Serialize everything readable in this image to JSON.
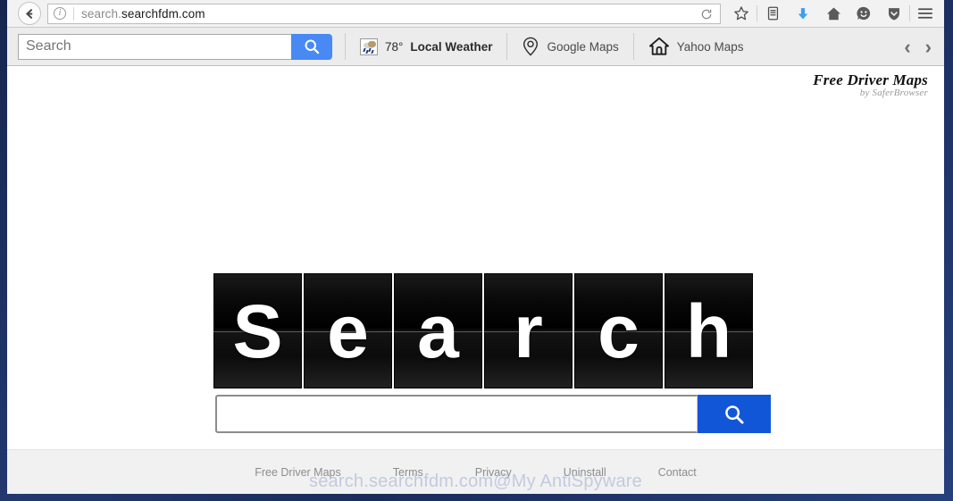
{
  "browser": {
    "back_icon": "back-arrow-icon",
    "site_info_icon": "info-circle-icon",
    "url_prefix": "search.",
    "url_domain": "searchfdm.com",
    "reload_icon": "reload-icon",
    "toolbar_icons": [
      {
        "name": "bookmark-star-icon",
        "glyph": "☆"
      },
      {
        "name": "library-icon",
        "glyph": "Ὅ6"
      },
      {
        "name": "downloads-icon",
        "glyph": "⬇"
      },
      {
        "name": "home-icon",
        "glyph": "⌂"
      },
      {
        "name": "smiley-face-icon",
        "glyph": "☺"
      },
      {
        "name": "shield-icon",
        "glyph": "⛊"
      },
      {
        "name": "hamburger-menu-icon",
        "glyph": "☰"
      }
    ]
  },
  "addon_toolbar": {
    "search_placeholder": "Search",
    "search_value": "",
    "search_button_icon": "magnifier-icon",
    "links": [
      {
        "name": "local-weather",
        "icon": "weather-icon",
        "temp": "78°",
        "label": "Local Weather"
      },
      {
        "name": "google-maps",
        "icon": "map-pin-icon",
        "label": "Google Maps"
      },
      {
        "name": "yahoo-maps",
        "icon": "home-outline-icon",
        "label": "Yahoo Maps"
      }
    ],
    "prev_arrow": "‹",
    "next_arrow": "›"
  },
  "page": {
    "brand_title": "Free Driver Maps",
    "brand_subtitle": "by SaferBrowser",
    "logo_letters": [
      "S",
      "e",
      "a",
      "r",
      "c",
      "h"
    ],
    "search_value": "",
    "search_placeholder": "",
    "search_button_icon": "magnifier-icon"
  },
  "footer": {
    "links": [
      {
        "name": "footer-link-free-driver-maps",
        "label": "Free Driver Maps"
      },
      {
        "name": "footer-link-terms",
        "label": "Terms"
      },
      {
        "name": "footer-link-privacy",
        "label": "Privacy"
      },
      {
        "name": "footer-link-uninstall",
        "label": "Uninstall"
      },
      {
        "name": "footer-link-contact",
        "label": "Contact"
      }
    ],
    "watermark": "search.searchfdm.com@My AntiSpyware"
  },
  "colors": {
    "accent_blue": "#1256d8",
    "toolbar_blue": "#4889f4",
    "frame_navy": "#1e3163",
    "footer_gray": "#f1f1f1"
  }
}
